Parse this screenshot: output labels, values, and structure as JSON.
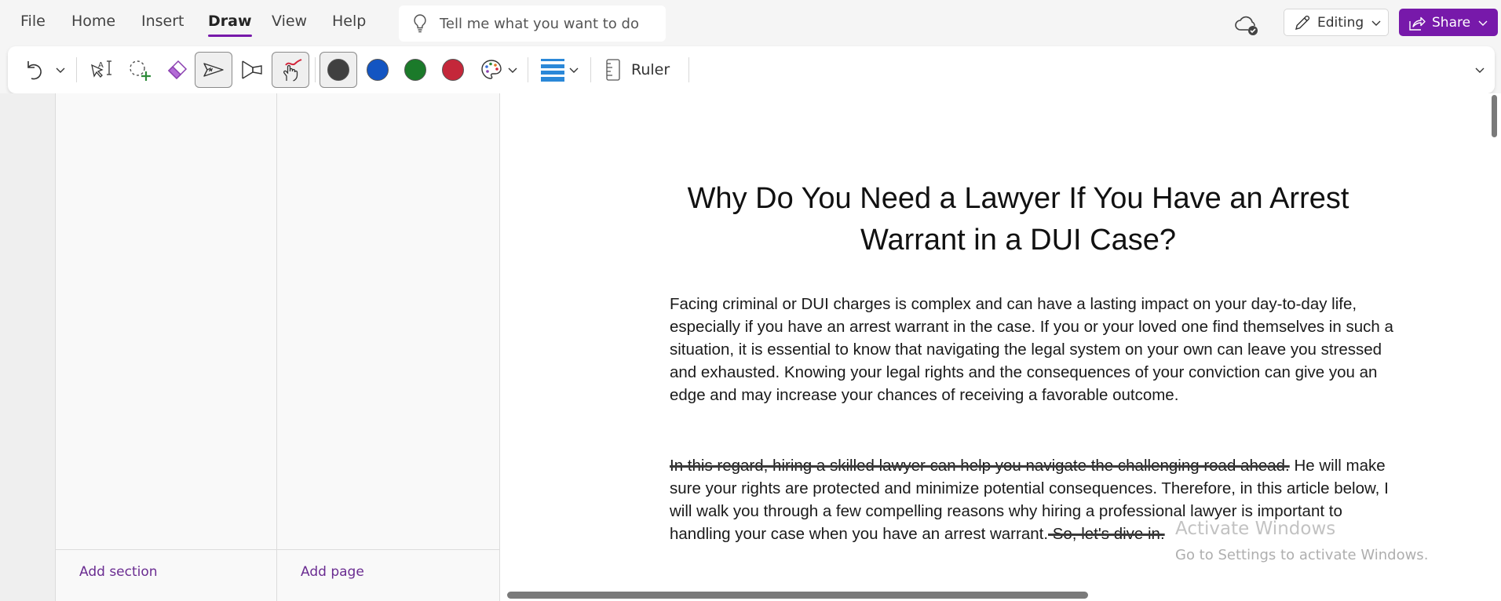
{
  "menu": {
    "tabs": [
      {
        "label": "File"
      },
      {
        "label": "Home"
      },
      {
        "label": "Insert"
      },
      {
        "label": "Draw",
        "active": true
      },
      {
        "label": "View"
      },
      {
        "label": "Help"
      }
    ]
  },
  "tell_me": {
    "placeholder": "Tell me what you want to do",
    "icon": "lightbulb-icon"
  },
  "header_right": {
    "sync_icon": "cloud-check-icon",
    "editing_label": "Editing",
    "share_label": "Share"
  },
  "ribbon": {
    "tools": [
      {
        "name": "undo",
        "icon": "undo-icon"
      },
      {
        "name": "type-select",
        "icon": "lasso-type-select-icon"
      },
      {
        "name": "lasso-select",
        "icon": "lasso-select-icon"
      },
      {
        "name": "eraser",
        "icon": "eraser-icon"
      },
      {
        "name": "pen",
        "icon": "pen-icon",
        "selected": true
      },
      {
        "name": "highlighter",
        "icon": "highlighter-icon"
      },
      {
        "name": "draw-with-touch",
        "icon": "touch-draw-icon",
        "selected": true
      }
    ],
    "colors": [
      {
        "name": "black",
        "hex": "#404040",
        "selected": true
      },
      {
        "name": "blue",
        "hex": "#1355c2"
      },
      {
        "name": "green",
        "hex": "#1b7a2a"
      },
      {
        "name": "red",
        "hex": "#c4273a"
      }
    ],
    "more_colors_icon": "palette-icon",
    "thickness_icon": "line-thickness-icon",
    "ruler_label": "Ruler"
  },
  "navigation": {
    "add_section_label": "Add section",
    "add_page_label": "Add page"
  },
  "page": {
    "title": "Why Do You Need a Lawyer If You Have an Arrest Warrant in a DUI Case?",
    "paragraph1": "Facing criminal or DUI charges is complex and can have a lasting impact on your day-to-day life, especially if you have an arrest warrant in the case. If you or your loved one find themselves in such a situation, it is essential to know that navigating the legal system on your own can leave you stressed and exhausted. Knowing your legal rights and the consequences of your conviction can give you an edge and may increase your chances of receiving a favorable outcome.",
    "paragraph2_struck_start": "In this regard, hiring a skilled lawyer can help you navigate the challenging road ahead.",
    "paragraph2_body": " He will make sure your rights are protected and minimize potential consequences. Therefore, in this article below, I will walk you through a few compelling reasons why hiring a professional lawyer is important to handling your case when you have an arrest warrant.",
    "paragraph2_struck_end": " So, let's dive in."
  },
  "watermark": {
    "line1": "Activate Windows",
    "line2": "Go to Settings to activate Windows."
  },
  "colors": {
    "accent": "#7719aa",
    "link": "#6a2c91"
  }
}
